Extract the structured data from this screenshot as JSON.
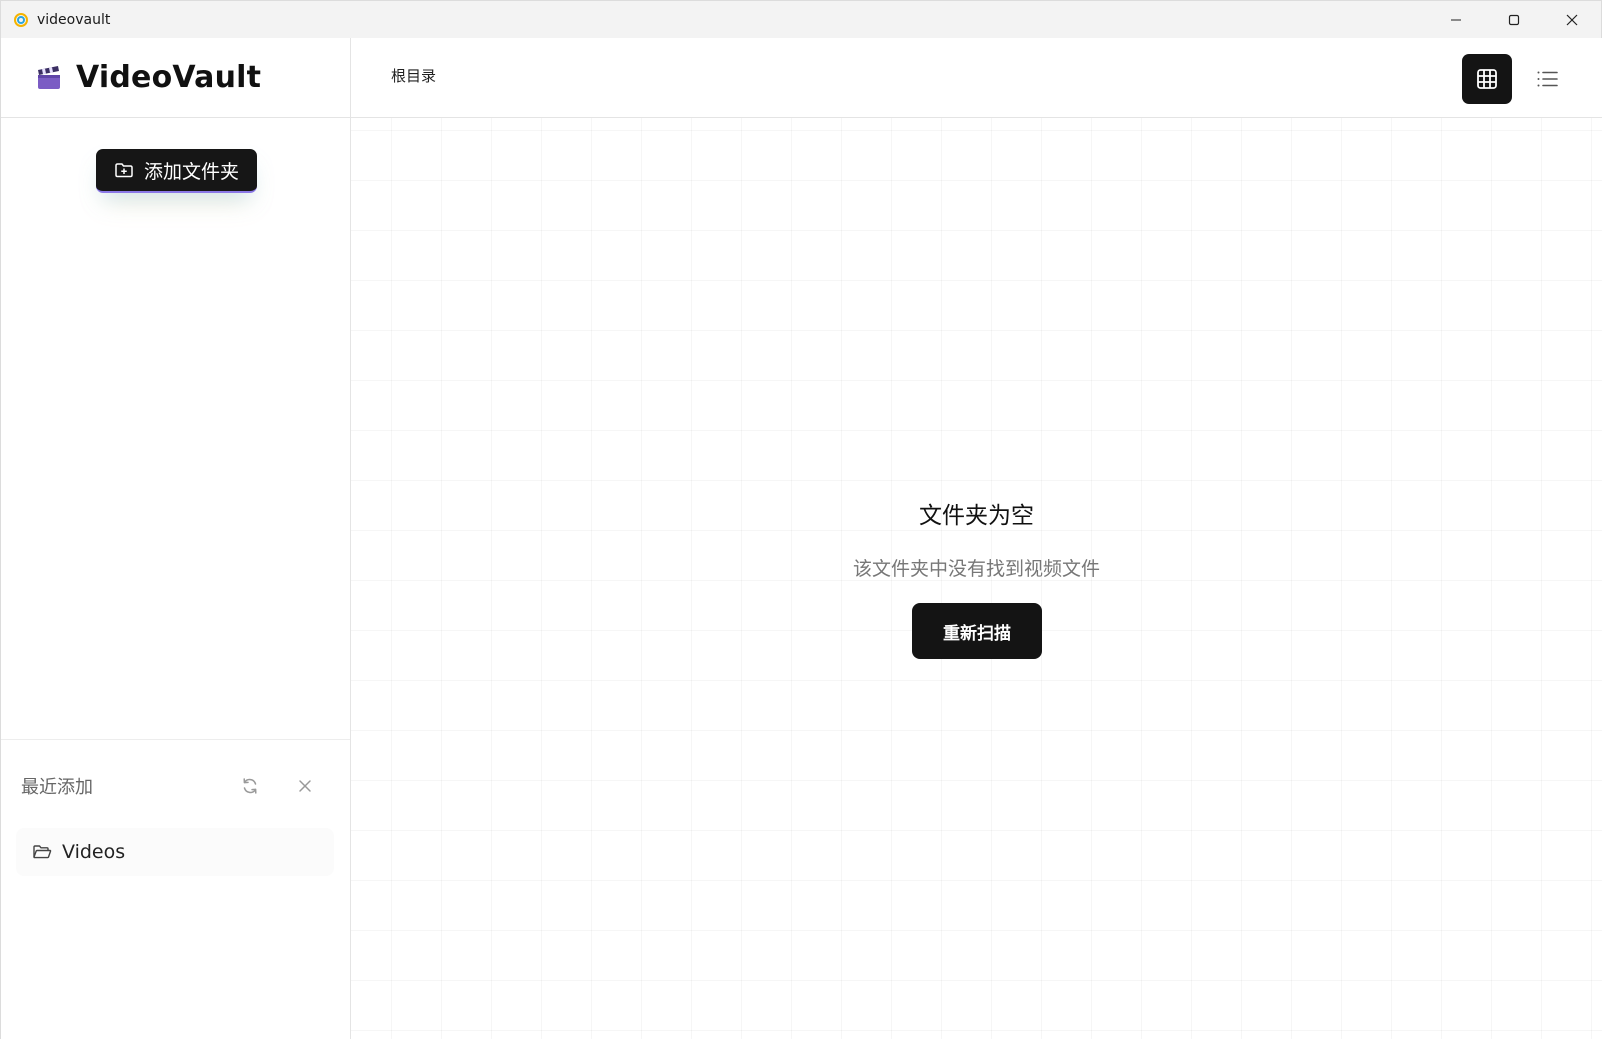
{
  "window": {
    "title": "videovault",
    "controls": {
      "minimize_icon": "minimize-icon",
      "maximize_icon": "maximize-icon",
      "close_icon": "close-icon"
    }
  },
  "sidebar": {
    "brand": {
      "name": "VideoVault",
      "icon": "clapperboard-icon"
    },
    "add_folder_button": {
      "label": "添加文件夹",
      "icon": "folder-plus-icon"
    },
    "recent": {
      "title": "最近添加",
      "refresh_icon": "refresh-icon",
      "clear_icon": "close-icon",
      "items": [
        {
          "label": "Videos",
          "icon": "folder-open-icon"
        }
      ]
    }
  },
  "topbar": {
    "breadcrumb": "根目录",
    "view_modes": [
      {
        "name": "grid",
        "icon": "grid-icon",
        "active": true
      },
      {
        "name": "list",
        "icon": "list-icon",
        "active": false
      }
    ]
  },
  "empty_state": {
    "title": "文件夹为空",
    "description": "该文件夹中没有找到视频文件",
    "rescan_label": "重新扫描"
  },
  "colors": {
    "accent_dark": "#141414",
    "button_underline": "#8b78e6",
    "brand_icon": "#7b5cc4"
  }
}
